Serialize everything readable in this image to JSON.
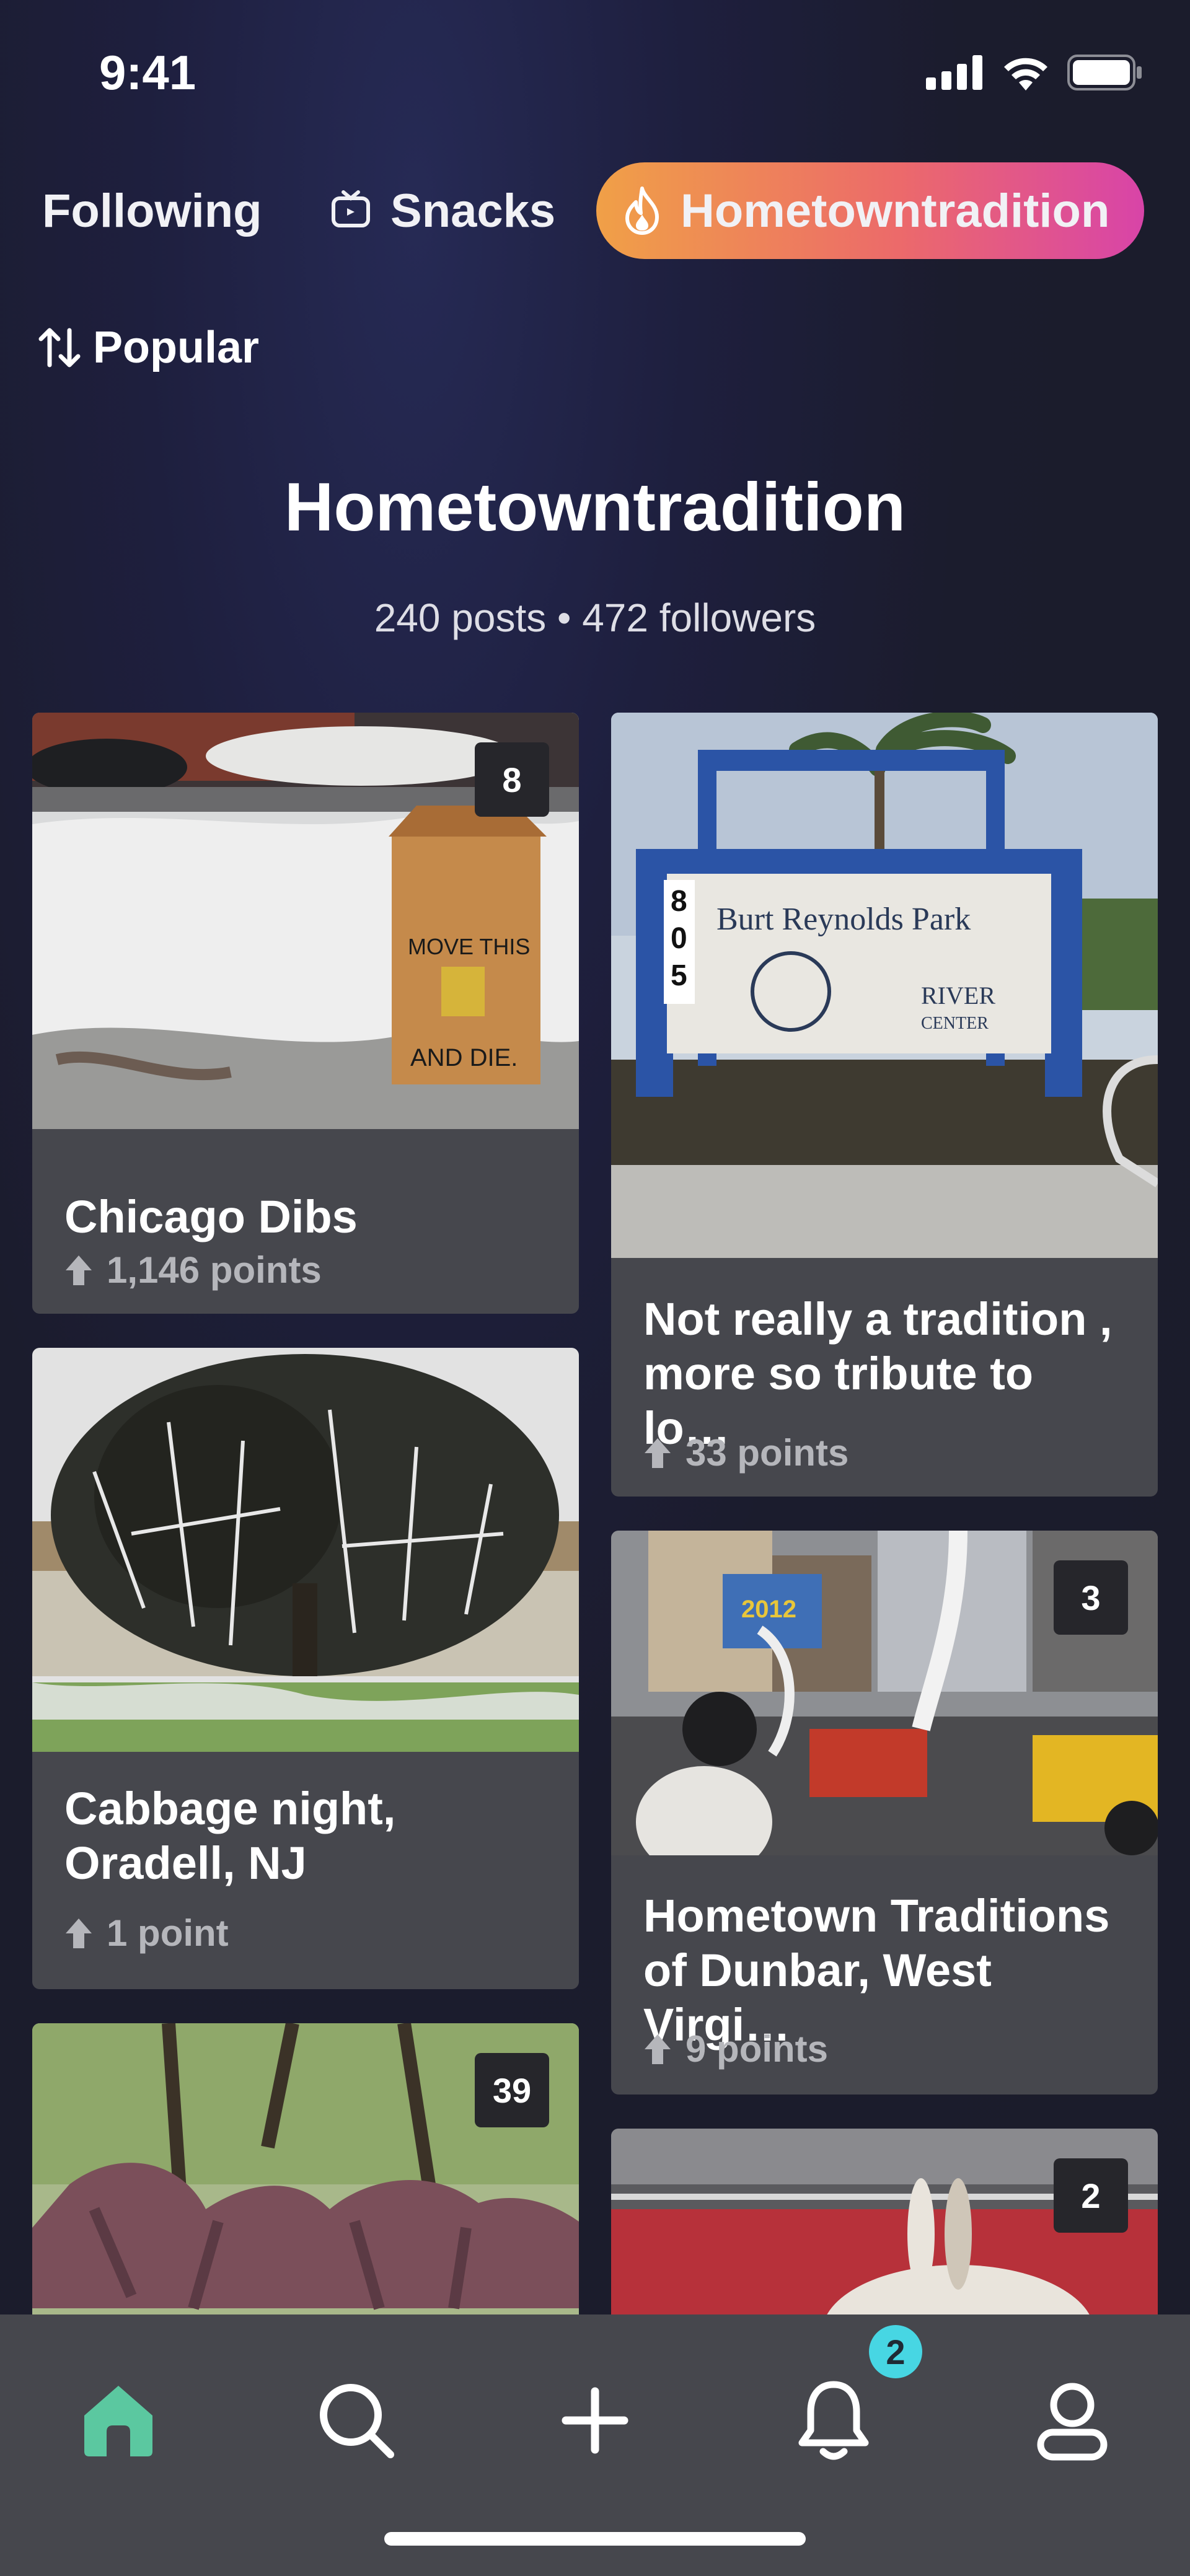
{
  "status_bar": {
    "time": "9:41"
  },
  "tabs": [
    {
      "label": "Following",
      "active": false
    },
    {
      "label": "Snacks",
      "icon": "tv-icon",
      "active": false
    },
    {
      "label": "Hometowntradition",
      "icon": "flame-icon",
      "active": true
    }
  ],
  "sort": {
    "label": "Popular",
    "icon": "sort-arrows-icon"
  },
  "header": {
    "title": "Hometowntradition",
    "stats": "240 posts • 472 followers"
  },
  "posts": [
    {
      "title": "Chicago Dibs",
      "points": "1,146 points",
      "image_count": "8",
      "image": "snowy street with cardboard box reading MOVE THIS AND DIE"
    },
    {
      "title": "Not really a tradition , more so tribute to lo…",
      "points": "33 points",
      "image": "Burt Reynolds Park sign with palm trees"
    },
    {
      "title": "Cabbage night, Oradell, NJ",
      "points": "1 point",
      "image": "tree covered in toilet paper"
    },
    {
      "title": "Hometown Traditions of Dunbar, West Virgi…",
      "points": "9 points",
      "image_count": "3",
      "image": "parade float King & Queen 2012"
    },
    {
      "title": "",
      "points": "",
      "image_count": "39",
      "image": "metal horse and rider sculpture under trees"
    },
    {
      "title": "",
      "points": "",
      "image_count": "2",
      "image": "rabbit in a red truck bed"
    }
  ],
  "nav": [
    {
      "name": "home",
      "icon": "home-icon",
      "active": true
    },
    {
      "name": "search",
      "icon": "search-icon"
    },
    {
      "name": "create",
      "icon": "plus-icon"
    },
    {
      "name": "notifications",
      "icon": "bell-icon",
      "badge": "2"
    },
    {
      "name": "profile",
      "icon": "profile-icon"
    }
  ],
  "colors": {
    "accent_gradient": [
      "#f0a047",
      "#ec6a6a",
      "#d844a8"
    ],
    "nav_active": "#5bc8a0",
    "notif_badge": "#47d6e3",
    "card_bg": "#46474d"
  }
}
